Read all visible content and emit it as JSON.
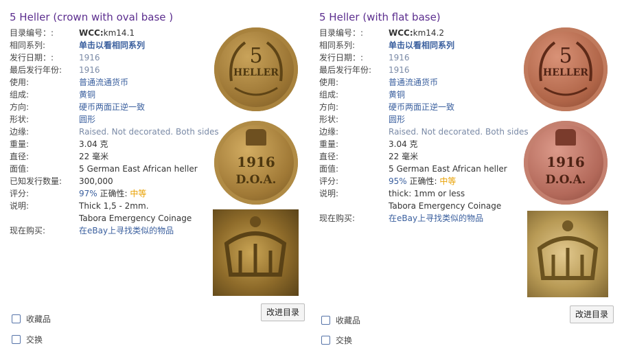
{
  "cards": [
    {
      "title": "5 Heller (crown with oval base )",
      "fields": [
        {
          "label": "目录编号：:",
          "value_bold": "WCC:",
          "value": "km14.1"
        },
        {
          "label": "相同系列:",
          "value": "单击以看相同系列"
        },
        {
          "label": "发行日期：:",
          "value": "1916"
        },
        {
          "label": "最后发行年份:",
          "value": "1916"
        },
        {
          "label": "使用:",
          "value": "普通流通货币"
        },
        {
          "label": "组成:",
          "value": "黄铜"
        },
        {
          "label": "方向:",
          "value": "硬币两面正逆一致"
        },
        {
          "label": "形状:",
          "value": "圆形"
        },
        {
          "label": "边缘:",
          "value": "Raised. Not decorated. Both sides"
        },
        {
          "label": "重量:",
          "value": "3.04 克"
        },
        {
          "label": "直径:",
          "value": "22 毫米"
        },
        {
          "label": "面值:",
          "value": "5 German East African heller"
        },
        {
          "label": "已知发行数量:",
          "value": "300,000"
        },
        {
          "label": "评分:",
          "value": "97%",
          "extra_label": " 正确性:",
          "extra_value": "中等"
        },
        {
          "label": "说明:",
          "value": "Thick 1,5 - 2mm."
        },
        {
          "label": "",
          "value": "Tabora Emergency Coinage"
        },
        {
          "label": "现在购买:",
          "value": "在eBay上寻找类似的物品"
        }
      ],
      "improve_button": "改进目录",
      "collect_label": "收藏品",
      "trade_label": "交换"
    },
    {
      "title": "5 Heller (with flat base)",
      "fields": [
        {
          "label": "目录编号：:",
          "value_bold": "WCC:",
          "value": "km14.2"
        },
        {
          "label": "相同系列:",
          "value": "单击以看相同系列"
        },
        {
          "label": "发行日期：:",
          "value": "1916"
        },
        {
          "label": "最后发行年份:",
          "value": "1916"
        },
        {
          "label": "使用:",
          "value": "普通流通货币"
        },
        {
          "label": "组成:",
          "value": "黄铜"
        },
        {
          "label": "方向:",
          "value": "硬币两面正逆一致"
        },
        {
          "label": "形状:",
          "value": "圆形"
        },
        {
          "label": "边缘:",
          "value": "Raised. Not decorated. Both sides"
        },
        {
          "label": "重量:",
          "value": "3.04 克"
        },
        {
          "label": "直径:",
          "value": "22 毫米"
        },
        {
          "label": "面值:",
          "value": "5 German East African heller"
        },
        {
          "label": "评分:",
          "value": "95%",
          "extra_label": " 正确性:",
          "extra_value": "中等"
        },
        {
          "label": "说明:",
          "value": "thick: 1mm or less"
        },
        {
          "label": "",
          "value": "Tabora Emergency Coinage"
        },
        {
          "label": "现在购买:",
          "value": "在eBay上寻找类似的物品"
        }
      ],
      "improve_button": "改进目录",
      "collect_label": "收藏品",
      "trade_label": "交换"
    }
  ],
  "coin_images": {
    "left_obverse_text": "5",
    "left_obverse_sub": "HELLER",
    "left_reverse_year": "1916",
    "left_reverse_sub": "D.O.A.",
    "right_obverse_text": "5",
    "right_obverse_sub": "HELLER",
    "right_reverse_year": "1916",
    "right_reverse_sub": "D.O.A."
  },
  "colors": {
    "title": "#5b2d8e",
    "link": "#3a5f9e",
    "edge_text": "#7a8aa6",
    "accuracy": "#e8a000"
  }
}
